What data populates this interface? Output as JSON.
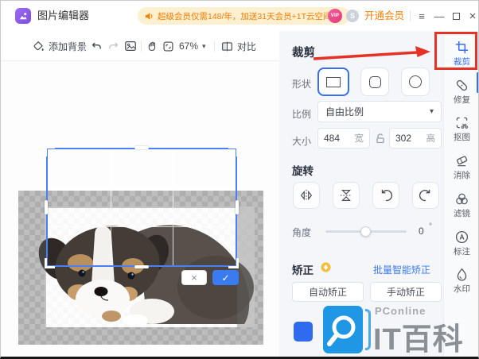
{
  "titlebar": {
    "app_title": "图片编辑器",
    "banner_text": "超级会员仅需148/年，加送31天会员+1T云空间",
    "banner_close": "×",
    "vip_badge": "VIP",
    "coin_badge": "S",
    "upgrade_label": "开通会员",
    "menu_glyph": "≡",
    "minimize_glyph": "—",
    "close_glyph": "×"
  },
  "toolbar": {
    "add_background_label": "添加背景",
    "zoom_value": "67%",
    "zoom_caret": "▾",
    "compare_label": "对比"
  },
  "canvas": {
    "crop_cancel_glyph": "×",
    "crop_confirm_glyph": "✓"
  },
  "crop_panel": {
    "title": "裁剪",
    "shape_label": "形状",
    "ratio_label": "比例",
    "ratio_value": "自由比例",
    "ratio_caret": "▾",
    "size_label": "大小",
    "width_value": "484",
    "width_unit": "宽",
    "height_value": "302",
    "height_unit": "高",
    "rotate_label": "旋转",
    "angle_label": "角度",
    "angle_value": "0",
    "angle_unit": "°",
    "correct_label": "矫正",
    "batch_correct_link": "批量智能矫正",
    "auto_correct_button": "自动矫正",
    "manual_correct_button": "手动矫正"
  },
  "sidebar": {
    "items": [
      {
        "label": "裁剪",
        "icon": "crop-icon",
        "active": true
      },
      {
        "label": "修复",
        "icon": "repair-icon",
        "active": false
      },
      {
        "label": "抠图",
        "icon": "cutout-icon",
        "active": false
      },
      {
        "label": "消除",
        "icon": "erase-icon",
        "active": false
      },
      {
        "label": "滤镜",
        "icon": "filter-icon",
        "active": false
      },
      {
        "label": "标注",
        "icon": "annotate-icon",
        "active": false
      },
      {
        "label": "水印",
        "icon": "watermark-icon",
        "active": false
      }
    ]
  },
  "watermark": {
    "brand": "PConline",
    "title": "IT百科"
  },
  "colors": {
    "accent_blue": "#3a6ef0",
    "brand_orange": "#f7820a",
    "annotation_red": "#e63226",
    "link_blue": "#3b7bf5",
    "vip_pink": "#e9498a",
    "logo_blue": "#2097e4"
  }
}
